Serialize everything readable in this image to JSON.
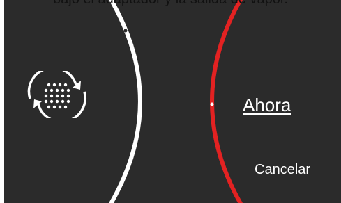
{
  "caption": {
    "text": "bajo el adaptador y la salida de vapor."
  },
  "screen": {
    "background_color": "#2b2b2b",
    "left_arc_color": "#ffffff",
    "right_arc_color": "#e32222",
    "icon": "sync-icon"
  },
  "actions": {
    "now_label": "Ahora",
    "cancel_label": "Cancelar"
  }
}
